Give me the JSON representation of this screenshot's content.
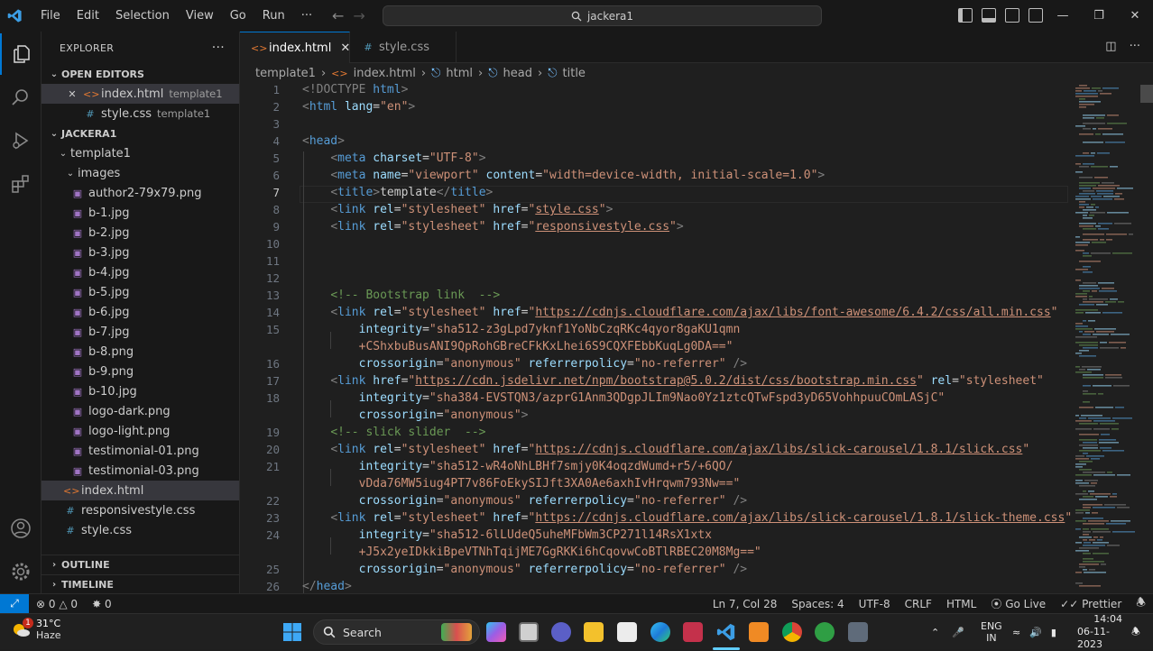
{
  "titlebar": {
    "menu": [
      "File",
      "Edit",
      "Selection",
      "View",
      "Go",
      "Run",
      "···"
    ],
    "search_text": "jackera1"
  },
  "sidebar": {
    "title": "EXPLORER",
    "more": "···",
    "open_editors_label": "OPEN EDITORS",
    "open_editors": [
      {
        "name": "index.html",
        "desc": "template1"
      },
      {
        "name": "style.css",
        "desc": "template1"
      }
    ],
    "workspace_label": "JACKERA1",
    "folder": "template1",
    "subfolder": "images",
    "images": [
      "author2-79x79.png",
      "b-1.jpg",
      "b-2.jpg",
      "b-3.jpg",
      "b-4.jpg",
      "b-5.jpg",
      "b-6.jpg",
      "b-7.jpg",
      "b-8.png",
      "b-9.png",
      "b-10.jpg",
      "logo-dark.png",
      "logo-light.png",
      "testimonial-01.png",
      "testimonial-03.png"
    ],
    "files": [
      "index.html",
      "responsivestyle.css",
      "style.css"
    ],
    "outline_label": "OUTLINE",
    "timeline_label": "TIMELINE"
  },
  "tabs": [
    {
      "label": "index.html"
    },
    {
      "label": "style.css"
    }
  ],
  "breadcrumbs": [
    "template1",
    "index.html",
    "html",
    "head",
    "title"
  ],
  "editor": {
    "line_numbers": [
      "1",
      "2",
      "3",
      "4",
      "5",
      "6",
      "7",
      "8",
      "9",
      "10",
      "11",
      "12",
      "13",
      "14",
      "15",
      "",
      "16",
      "17",
      "18",
      "",
      "19",
      "20",
      "21",
      "",
      "22",
      "23",
      "24",
      "",
      "25",
      "26"
    ],
    "lines": {
      "l1a": "<!DOCTYPE ",
      "l1b": "html",
      "l1c": ">",
      "l2a": "<",
      "l2b": "html",
      "l2c": " lang",
      "l2d": "=",
      "l2e": "\"en\"",
      "l2f": ">",
      "l4a": "<",
      "l4b": "head",
      "l4c": ">",
      "l5": "charset",
      "l5v": "\"UTF-8\"",
      "l6a": "name",
      "l6b": "\"viewport\"",
      "l6c": "content",
      "l6d": "\"width=device-width, initial-scale=1.0\"",
      "l7": "template",
      "l8v": "style.css",
      "l9v": "responsivestyle.css",
      "l13": "<!-- Bootstrap link  -->",
      "l14v": "https://cdnjs.cloudflare.com/ajax/libs/font-awesome/6.4.2/css/all.min.css",
      "l15a": "\"sha512-z3gLpd7yknf1YoNbCzqRKc4qyor8gaKU1qmn",
      "l15b": "+CShxbuBusANI9QpRohGBreCFkKxLhei6S9CQXFEbbKuqLg0DA==\"",
      "l16a": "\"anonymous\"",
      "l16b": "\"no-referrer\"",
      "l17v": "https://cdn.jsdelivr.net/npm/bootstrap@5.0.2/dist/css/bootstrap.min.css",
      "l17r": "\"stylesheet\"",
      "l18": "\"sha384-EVSTQN3/azprG1Anm3QDgpJLIm9Nao0Yz1ztcQTwFspd3yD65VohhpuuCOmLASjC\"",
      "l18b": "\"anonymous\"",
      "l19": "<!-- slick slider  -->",
      "l20v": "https://cdnjs.cloudflare.com/ajax/libs/slick-carousel/1.8.1/slick.css",
      "l21a": "\"sha512-wR4oNhLBHf7smjy0K4oqzdWumd+r5/+6QO/",
      "l21b": "vDda76MW5iug4PT7v86FoEkySIJft3XA0Ae6axhIvHrqwm793Nw==\"",
      "l23v": "https://cdnjs.cloudflare.com/ajax/libs/slick-carousel/1.8.1/slick-theme.css",
      "l24a": "\"sha512-6lLUdeQ5uheMFbWm3CP271l14RsX1xtx",
      "l24b": "+J5x2yeIDkkiBpeVTNhTqijME7GgRKKi6hCqovwCoBTlRBEC20M8Mg==\"",
      "l26": "head",
      "meta": "meta",
      "link": "link",
      "title": "title",
      "rel": "rel",
      "href": "href",
      "stylesheet": "\"stylesheet\"",
      "integrity": "integrity",
      "crossorigin": "crossorigin",
      "referrerpolicy": "referrerpolicy"
    }
  },
  "status": {
    "errors": "0",
    "warnings": "0",
    "ports": "0",
    "position": "Ln 7, Col 28",
    "spaces": "Spaces: 4",
    "encoding": "UTF-8",
    "eol": "CRLF",
    "language": "HTML",
    "golive": "Go Live",
    "prettier": "Prettier"
  },
  "taskbar": {
    "weather_temp": "31°C",
    "weather_desc": "Haze",
    "weather_badge": "1",
    "search": "Search",
    "lang1": "ENG",
    "lang2": "IN",
    "time": "14:04",
    "date": "06-11-2023"
  },
  "colors": {
    "accent": "#0078d4",
    "bg": "#1f1f1f",
    "sidebar": "#181818"
  }
}
